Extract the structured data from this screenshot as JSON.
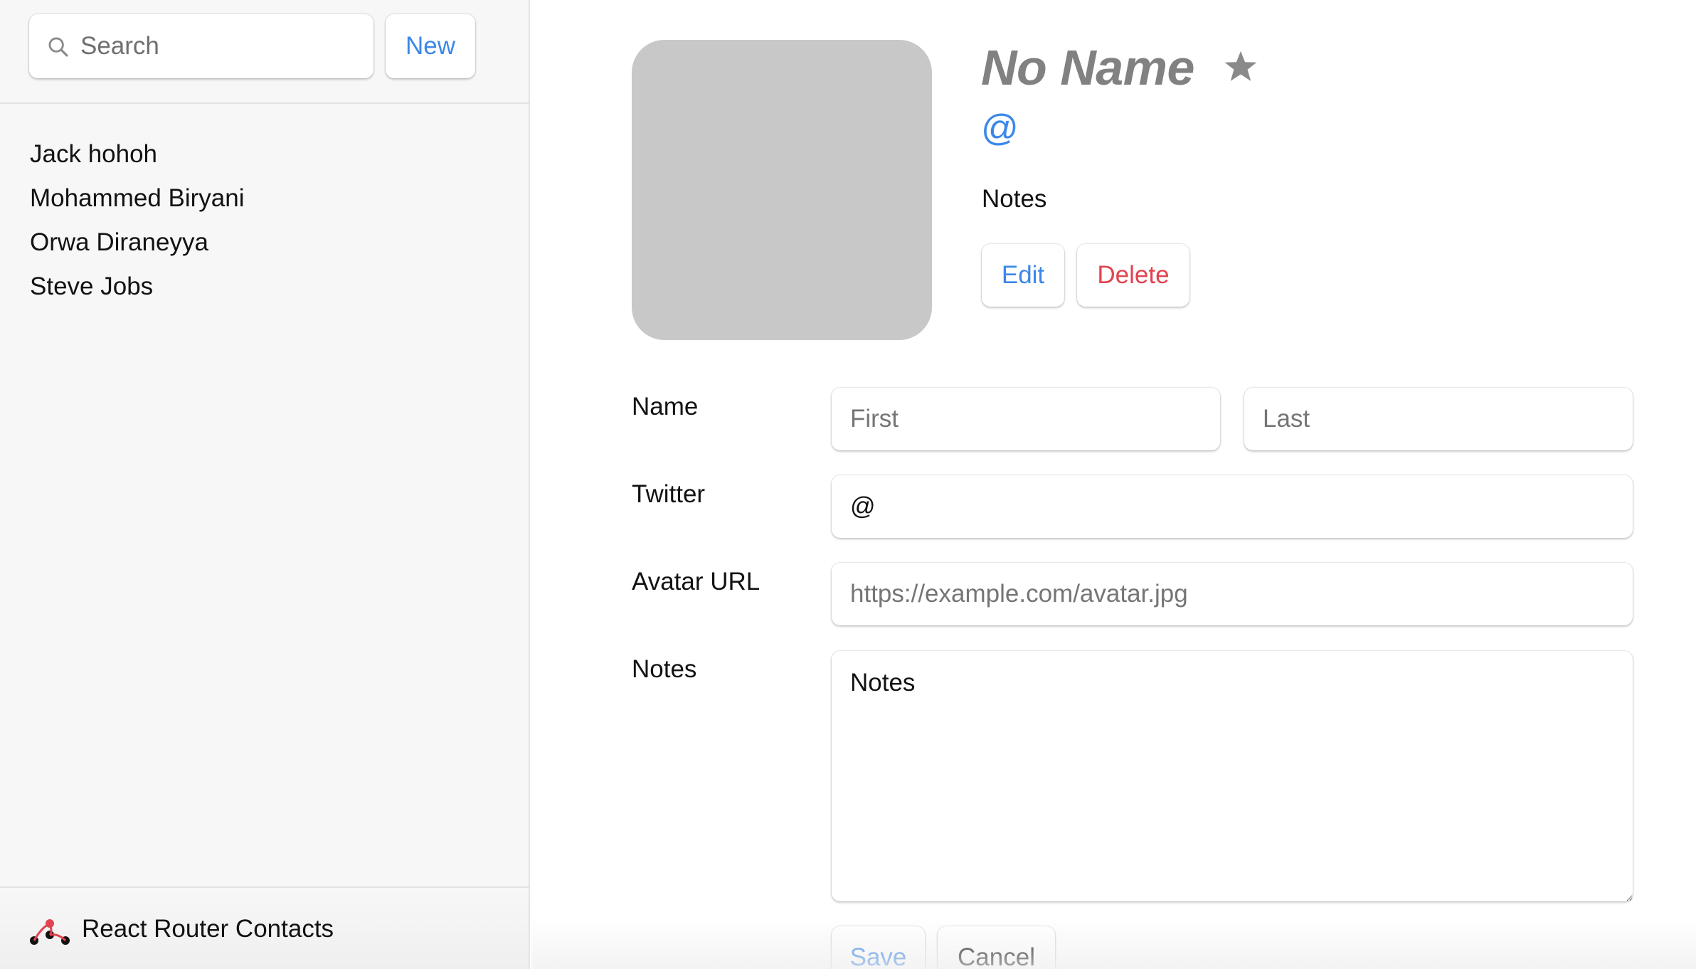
{
  "sidebar": {
    "search": {
      "placeholder": "Search",
      "value": ""
    },
    "new_button_label": "New",
    "contacts": [
      {
        "name": "Jack hohoh"
      },
      {
        "name": "Mohammed Biryani"
      },
      {
        "name": "Orwa Diraneyya"
      },
      {
        "name": "Steve Jobs"
      }
    ],
    "footer": {
      "title": "React Router Contacts",
      "logo_icon": "react-router-logo-icon"
    }
  },
  "contact": {
    "name": "No Name",
    "favorite_icon": "star-icon",
    "twitter": "@",
    "notes": "Notes",
    "edit_label": "Edit",
    "delete_label": "Delete"
  },
  "form": {
    "name_label": "Name",
    "first_placeholder": "First",
    "last_placeholder": "Last",
    "twitter_label": "Twitter",
    "twitter_value": "@",
    "avatar_label": "Avatar URL",
    "avatar_placeholder": "https://example.com/avatar.jpg",
    "notes_label": "Notes",
    "notes_value": "Notes",
    "save_label": "Save",
    "cancel_label": "Cancel"
  },
  "colors": {
    "accent": "#3b88e9",
    "danger": "#e1434f",
    "avatar_placeholder": "#c8c8c8",
    "sidebar_bg": "#f7f7f7",
    "name_gray": "#818181"
  }
}
